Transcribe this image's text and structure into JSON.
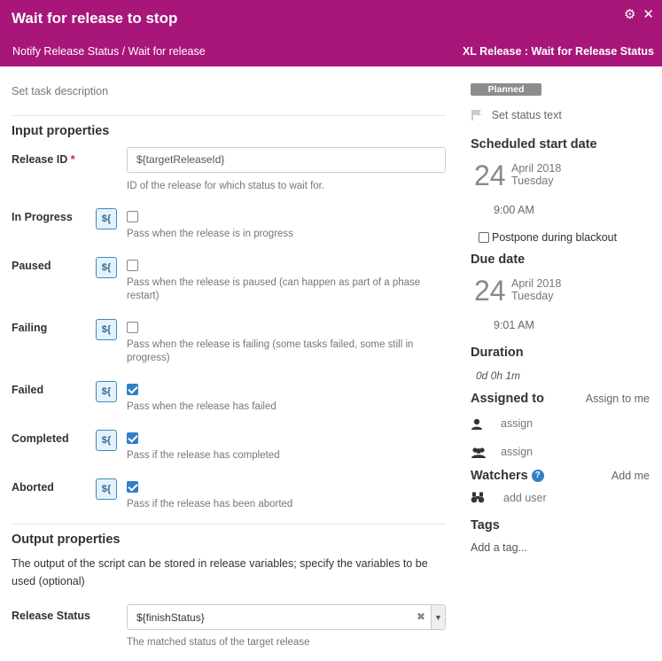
{
  "header": {
    "title": "Wait for release to stop",
    "breadcrumb": "Notify Release Status / Wait for release",
    "task_type": "XL Release : Wait for Release Status",
    "gear_glyph": "⚙",
    "close_glyph": "✕"
  },
  "left": {
    "description_placeholder": "Set task description",
    "input_section_title": "Input properties",
    "release_id": {
      "label": "Release ID",
      "required_mark": "*",
      "value": "${targetReleaseId}",
      "help": "ID of the release for which status to wait for."
    },
    "var_button_label": "${",
    "checkboxes": [
      {
        "label": "In Progress",
        "checked": false,
        "help": "Pass when the release is in progress"
      },
      {
        "label": "Paused",
        "checked": false,
        "help": "Pass when the release is paused (can happen as part of a phase restart)"
      },
      {
        "label": "Failing",
        "checked": false,
        "help": "Pass when the release is failing (some tasks failed, some still in progress)"
      },
      {
        "label": "Failed",
        "checked": true,
        "help": "Pass when the release has failed"
      },
      {
        "label": "Completed",
        "checked": true,
        "help": "Pass if the release has completed"
      },
      {
        "label": "Aborted",
        "checked": true,
        "help": "Pass if the release has been aborted"
      }
    ],
    "output_section_title": "Output properties",
    "output_description": "The output of the script can be stored in release variables; specify the variables to be used (optional)",
    "release_status": {
      "label": "Release Status",
      "value": "${finishStatus}",
      "clear_glyph": "✖",
      "arrow_glyph": "▼",
      "help": "The matched status of the target release"
    }
  },
  "right": {
    "status_badge": "Planned",
    "status_text_placeholder": "Set status text",
    "scheduled_start": {
      "title": "Scheduled start date",
      "day": "24",
      "month_year": "April 2018",
      "weekday": "Tuesday",
      "time": "9:00 AM"
    },
    "postpone_label": "Postpone during blackout",
    "postpone_checked": false,
    "due_date": {
      "title": "Due date",
      "day": "24",
      "month_year": "April 2018",
      "weekday": "Tuesday",
      "time": "9:01 AM"
    },
    "duration": {
      "title": "Duration",
      "value": "0d 0h 1m"
    },
    "assigned": {
      "title": "Assigned to",
      "assign_to_me": "Assign to me",
      "user_placeholder": "assign",
      "team_placeholder": "assign"
    },
    "watchers": {
      "title": "Watchers",
      "help_glyph": "?",
      "add_me": "Add me",
      "add_user": "add user"
    },
    "tags": {
      "title": "Tags",
      "add_tag": "Add a tag..."
    }
  },
  "colors": {
    "header_bg": "#a8167a",
    "accent_blue": "#2f80c5",
    "badge_gray": "#8c8c8c"
  }
}
